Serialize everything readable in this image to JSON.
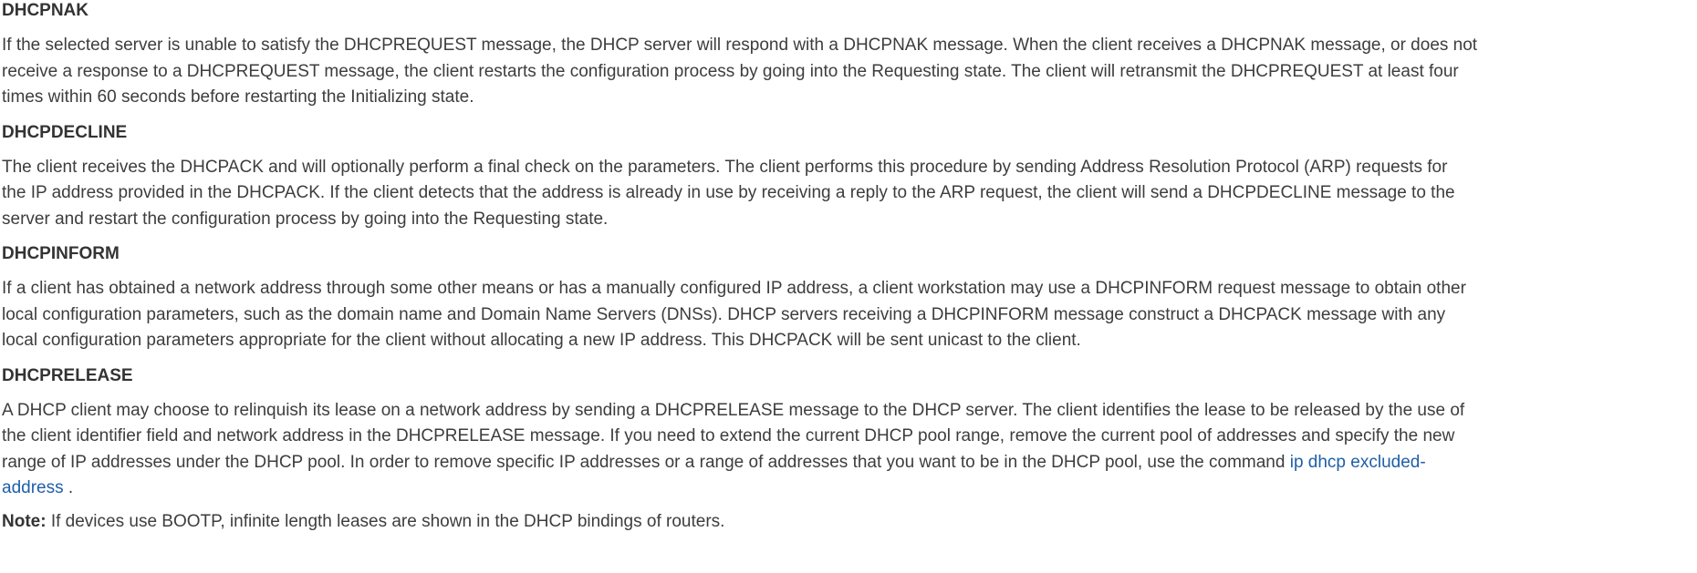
{
  "sections": [
    {
      "heading": "DHCPNAK",
      "lines": [
        "If the selected server is unable to satisfy the DHCPREQUEST message, the DHCP server will respond with a DHCPNAK message. When the client receives a DHCPNAK message, or does not",
        "receive a response to a DHCPREQUEST message, the client restarts the configuration process by going into the Requesting state. The client will retransmit the DHCPREQUEST at least four",
        "times within 60 seconds before restarting the Initializing state."
      ]
    },
    {
      "heading": "DHCPDECLINE",
      "lines": [
        "The client receives the DHCPACK and will optionally perform a final check on the parameters. The client performs this procedure by sending Address Resolution Protocol (ARP) requests for",
        "the IP address provided in the DHCPACK. If the client detects that the address is already in use by receiving a reply to the ARP request, the client will send a DHCPDECLINE message to the",
        "server and restart the configuration process by going into the Requesting state."
      ]
    },
    {
      "heading": "DHCPINFORM",
      "lines": [
        "If a client has obtained a network address through some other means or has a manually configured IP address, a client workstation may use a DHCPINFORM request message to obtain other",
        "local configuration parameters, such as the domain name and Domain Name Servers (DNSs). DHCP servers receiving a DHCPINFORM message construct a DHCPACK message with any",
        "local configuration parameters appropriate for the client without allocating a new IP address. This DHCPACK will be sent unicast to the client."
      ]
    },
    {
      "heading": "DHCPRELEASE",
      "lines": [
        "A DHCP client may choose to relinquish its lease on a network address by sending a DHCPRELEASE message to the DHCP server. The client identifies the lease to be released by the use of",
        "the client identifier field and network address in the DHCPRELEASE message. If you need to extend the current DHCP pool range, remove the current pool of addresses and specify the new",
        "range of IP addresses under the DHCP pool. In order to remove specific IP addresses or a range of addresses that you want to be in the DHCP pool, use the command "
      ],
      "link_part1": "ip dhcp excluded-",
      "link_part2": "address",
      "tail": " ."
    }
  ],
  "note": {
    "label": "Note:",
    "text": " If devices use BOOTP, infinite length leases are shown in the DHCP bindings of routers."
  },
  "colors": {
    "text": "#3d3d3d",
    "heading": "#333333",
    "link": "#1f5fa8"
  }
}
